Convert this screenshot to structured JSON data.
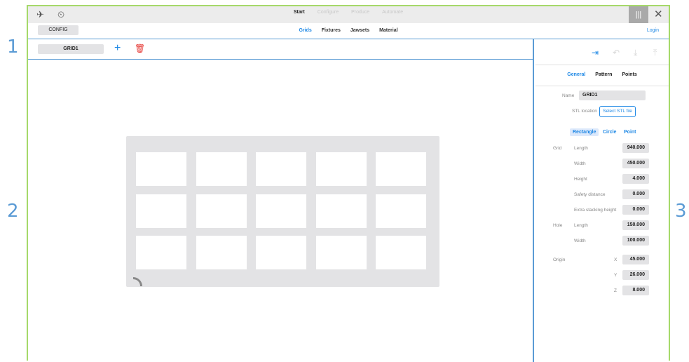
{
  "callouts": [
    "1",
    "2",
    "3"
  ],
  "topbar": {
    "nav": [
      "Start",
      "Configure",
      "Produce",
      "Automate"
    ],
    "active_nav": "Start"
  },
  "secondbar": {
    "config_label": "CONFIG",
    "tabs": [
      "Grids",
      "Fixtures",
      "Jawsets",
      "Material"
    ],
    "active_tab": "Grids",
    "login_label": "Login"
  },
  "grid_toolbar": {
    "grid_tab_label": "GRID1"
  },
  "plate": {
    "rows": 3,
    "cols": 5
  },
  "right_panel": {
    "tabs": [
      "General",
      "Pattern",
      "Points"
    ],
    "active_tab": "General",
    "name_label": "Name",
    "name_value": "GRID1",
    "stl_label": "STL location",
    "stl_button": "Select STL file",
    "shape_options": [
      "Rectangle",
      "Circle",
      "Point"
    ],
    "active_shape": "Rectangle",
    "grid_label": "Grid",
    "hole_label": "Hole",
    "origin_label": "Origin",
    "grid_fields": [
      {
        "label": "Length",
        "value": "940.000"
      },
      {
        "label": "Width",
        "value": "450.000"
      },
      {
        "label": "Height",
        "value": "4.000"
      },
      {
        "label": "Safety distance",
        "value": "0.000"
      },
      {
        "label": "Extra stacking height",
        "value": "0.000"
      }
    ],
    "hole_fields": [
      {
        "label": "Length",
        "value": "150.000"
      },
      {
        "label": "Width",
        "value": "100.000"
      }
    ],
    "origin_fields": [
      {
        "label": "X",
        "value": "45.000"
      },
      {
        "label": "Y",
        "value": "26.000"
      },
      {
        "label": "Z",
        "value": "8.000"
      }
    ]
  }
}
